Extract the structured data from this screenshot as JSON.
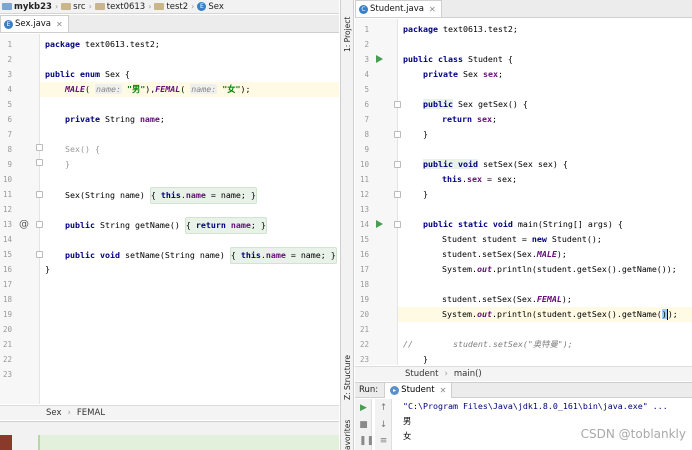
{
  "navbar": {
    "crumbs": [
      "mykb23",
      "src",
      "text0613",
      "test2",
      "Sex"
    ]
  },
  "left_editor": {
    "tab": "Sex.java",
    "lines": [
      {
        "n": "1"
      },
      {
        "n": "2"
      },
      {
        "n": "3"
      },
      {
        "n": "4"
      },
      {
        "n": "5"
      },
      {
        "n": "6"
      },
      {
        "n": "7"
      },
      {
        "n": "8"
      },
      {
        "n": "9"
      },
      {
        "n": "10"
      },
      {
        "n": "11"
      },
      {
        "n": "12"
      },
      {
        "n": "13"
      },
      {
        "n": "14"
      },
      {
        "n": "15"
      },
      {
        "n": "16"
      },
      {
        "n": "17"
      },
      {
        "n": "18"
      },
      {
        "n": "19"
      },
      {
        "n": "20"
      },
      {
        "n": "21"
      },
      {
        "n": "22"
      },
      {
        "n": "23"
      }
    ],
    "code": {
      "l1_kw": "package",
      "l1_rest": " text0613.test2;",
      "l3_kw": "public enum",
      "l3_rest": " Sex {",
      "l4_a": "MALE",
      "l4_b": "( ",
      "l4_hint1": "name:",
      "l4_s1": " \"男\"",
      "l4_c": "),",
      "l4_d": "FEMAL",
      "l4_e": "( ",
      "l4_hint2": "name:",
      "l4_s2": " \"女\"",
      "l4_f": ");",
      "l6_kw": "private",
      "l6_rest": " String ",
      "l6_fld": "name",
      "l6_end": ";",
      "l8": "Sex() {",
      "l9": "}",
      "l11_a": "Sex(String name) ",
      "l11_b": "{ ",
      "l11_kw": "this",
      "l11_c": ".",
      "l11_fld": "name",
      "l11_d": " = name; }",
      "l15_kw": "public",
      "l15_a": " String getName() ",
      "l15_b": "{ ",
      "l15_kw2": "return",
      "l15_c": " ",
      "l15_fld": "name",
      "l15_d": "; }",
      "l19_kw": "public void",
      "l19_a": " setName(String name) ",
      "l19_b": "{ ",
      "l19_kw2": "this",
      "l19_c": ".",
      "l19_fld": "name",
      "l19_d": " = name; }",
      "l22": "}"
    },
    "breadcrumb": [
      "Sex",
      "FEMAL"
    ],
    "gutter_at": "@"
  },
  "right_editor": {
    "tab": "Student.java",
    "lines": [
      {
        "n": "1"
      },
      {
        "n": "2"
      },
      {
        "n": "3"
      },
      {
        "n": "4"
      },
      {
        "n": "5"
      },
      {
        "n": "6"
      },
      {
        "n": "7"
      },
      {
        "n": "8"
      },
      {
        "n": "9"
      },
      {
        "n": "10"
      },
      {
        "n": "11"
      },
      {
        "n": "12"
      },
      {
        "n": "13"
      },
      {
        "n": "14"
      },
      {
        "n": "15"
      },
      {
        "n": "16"
      },
      {
        "n": "17"
      },
      {
        "n": "18"
      },
      {
        "n": "19"
      },
      {
        "n": "20"
      },
      {
        "n": "21"
      },
      {
        "n": "22"
      },
      {
        "n": "23"
      }
    ],
    "code": {
      "l1_kw": "package",
      "l1_rest": " text0613.test2;",
      "l3_kw": "public class",
      "l3_rest": " Student {",
      "l4_kw": "private",
      "l4_rest": " Sex ",
      "l4_fld": "sex",
      "l4_end": ";",
      "l6_kw": "public",
      "l6_rest": " Sex getSex() {",
      "l7_kw": "return",
      "l7_rest": " ",
      "l7_fld": "sex",
      "l7_end": ";",
      "l8": "}",
      "l10_kw": "public void",
      "l10_rest": " setSex(Sex sex) {",
      "l11_kw": "this",
      "l11_a": ".",
      "l11_fld": "sex",
      "l11_b": " = sex;",
      "l12": "}",
      "l14_kw": "public static void",
      "l14_rest": " main(String[] args) {",
      "l15_a": "Student student = ",
      "l15_kw": "new",
      "l15_b": " Student();",
      "l16_a": "student.setSex(Sex.",
      "l16_f": "MALE",
      "l16_b": ");",
      "l17_a": "System.",
      "l17_f": "out",
      "l17_b": ".println(student.getSex().getName());",
      "l19_a": "student.setSex(Sex.",
      "l19_f": "FEMAL",
      "l19_b": ");",
      "l20_a": "System.",
      "l20_f": "out",
      "l20_b": ".println(student.getSex().getName(",
      "l20_c": ")",
      "l20_d": ");",
      "l22": "//        student.setSex(\"奥特曼\");",
      "l23": "}"
    },
    "breadcrumb": [
      "Student",
      "main()"
    ]
  },
  "side_strip": {
    "top_label": "1: Project",
    "mid_label": "Z: Structure",
    "bottom_label": "avorites"
  },
  "run_panel": {
    "label": "Run:",
    "tab": "Student",
    "output": [
      "\"C:\\Program Files\\Java\\jdk1.8.0_161\\bin\\java.exe\" ...",
      "男",
      "女"
    ]
  },
  "watermark": "CSDN @toblankly",
  "icons": [
    "folder-icon",
    "class-icon",
    "run-gutter-icon",
    "rerun-icon",
    "stop-icon",
    "scroll-up-icon",
    "scroll-down-icon",
    "wrap-icon"
  ]
}
